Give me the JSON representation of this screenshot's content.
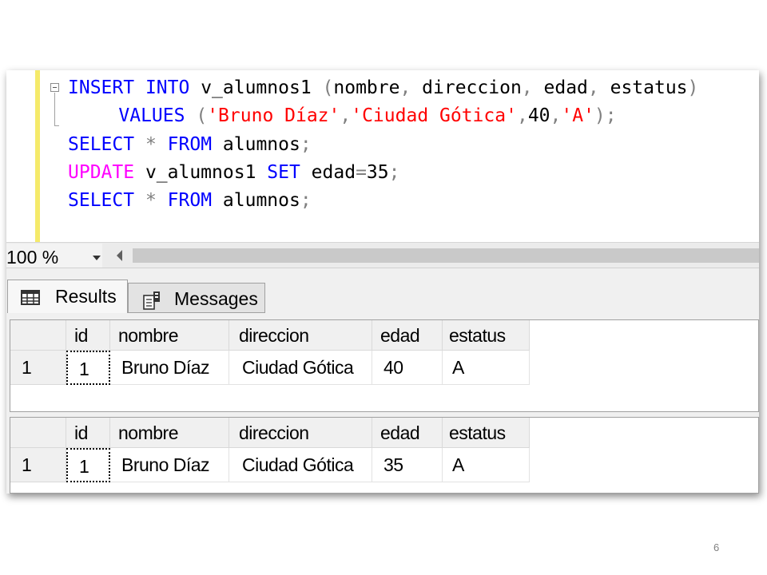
{
  "editor": {
    "lines": [
      {
        "segments": [
          {
            "text": "INSERT",
            "kind": "kw"
          },
          {
            "text": " ",
            "kind": "plain"
          },
          {
            "text": "INTO",
            "kind": "kw"
          },
          {
            "text": " v_alumnos1 ",
            "kind": "plain"
          },
          {
            "text": "(",
            "kind": "pun"
          },
          {
            "text": "nombre",
            "kind": "plain"
          },
          {
            "text": ", ",
            "kind": "pun"
          },
          {
            "text": "direccion",
            "kind": "plain"
          },
          {
            "text": ", ",
            "kind": "pun"
          },
          {
            "text": "edad",
            "kind": "plain"
          },
          {
            "text": ", ",
            "kind": "pun"
          },
          {
            "text": "estatus",
            "kind": "plain"
          },
          {
            "text": ")",
            "kind": "pun"
          }
        ]
      },
      {
        "segments": [
          {
            "text": "    ",
            "kind": "plain"
          },
          {
            "text": "VALUES",
            "kind": "kw"
          },
          {
            "text": " ",
            "kind": "plain"
          },
          {
            "text": "(",
            "kind": "pun"
          },
          {
            "text": "'Bruno Díaz'",
            "kind": "str"
          },
          {
            "text": ",",
            "kind": "pun"
          },
          {
            "text": "'Ciudad Gótica'",
            "kind": "str"
          },
          {
            "text": ",",
            "kind": "pun"
          },
          {
            "text": "40",
            "kind": "plain"
          },
          {
            "text": ",",
            "kind": "pun"
          },
          {
            "text": "'A'",
            "kind": "str"
          },
          {
            "text": ");",
            "kind": "pun"
          }
        ]
      },
      {
        "segments": [
          {
            "text": "SELECT",
            "kind": "kw"
          },
          {
            "text": " ",
            "kind": "plain"
          },
          {
            "text": "*",
            "kind": "pun"
          },
          {
            "text": " ",
            "kind": "plain"
          },
          {
            "text": "FROM",
            "kind": "kw"
          },
          {
            "text": " alumnos",
            "kind": "plain"
          },
          {
            "text": ";",
            "kind": "pun"
          }
        ]
      },
      {
        "segments": [
          {
            "text": "UPDATE",
            "kind": "kw2"
          },
          {
            "text": " v_alumnos1 ",
            "kind": "plain"
          },
          {
            "text": "SET",
            "kind": "kw"
          },
          {
            "text": " edad",
            "kind": "plain"
          },
          {
            "text": "=",
            "kind": "pun"
          },
          {
            "text": "35",
            "kind": "plain"
          },
          {
            "text": ";",
            "kind": "pun"
          }
        ]
      },
      {
        "segments": [
          {
            "text": "SELECT",
            "kind": "kw"
          },
          {
            "text": " ",
            "kind": "plain"
          },
          {
            "text": "*",
            "kind": "pun"
          },
          {
            "text": " ",
            "kind": "plain"
          },
          {
            "text": "FROM",
            "kind": "kw"
          },
          {
            "text": " alumnos",
            "kind": "plain"
          },
          {
            "text": ";",
            "kind": "pun"
          }
        ]
      }
    ]
  },
  "zoom": {
    "value": "100 %"
  },
  "tabs": {
    "results": "Results",
    "messages": "Messages"
  },
  "result_grids": [
    {
      "columns": [
        "id",
        "nombre",
        "direccion",
        "edad",
        "estatus"
      ],
      "rows": [
        {
          "row_number": "1",
          "cells": [
            "1",
            "Bruno Díaz",
            "Ciudad Gótica",
            "40",
            "A"
          ]
        }
      ]
    },
    {
      "columns": [
        "id",
        "nombre",
        "direccion",
        "edad",
        "estatus"
      ],
      "rows": [
        {
          "row_number": "1",
          "cells": [
            "1",
            "Bruno Díaz",
            "Ciudad Gótica",
            "35",
            "A"
          ]
        }
      ]
    }
  ],
  "page_number": "6",
  "colors": {
    "keyword": "#0000ff",
    "keyword_update": "#ff00ff",
    "string": "#ff0000",
    "punctuation": "#808080",
    "change_bar": "#f5ea6a"
  },
  "icons": {
    "fold": "collapse-minus-icon",
    "results_tab": "grid-icon",
    "messages_tab": "messages-icon"
  }
}
